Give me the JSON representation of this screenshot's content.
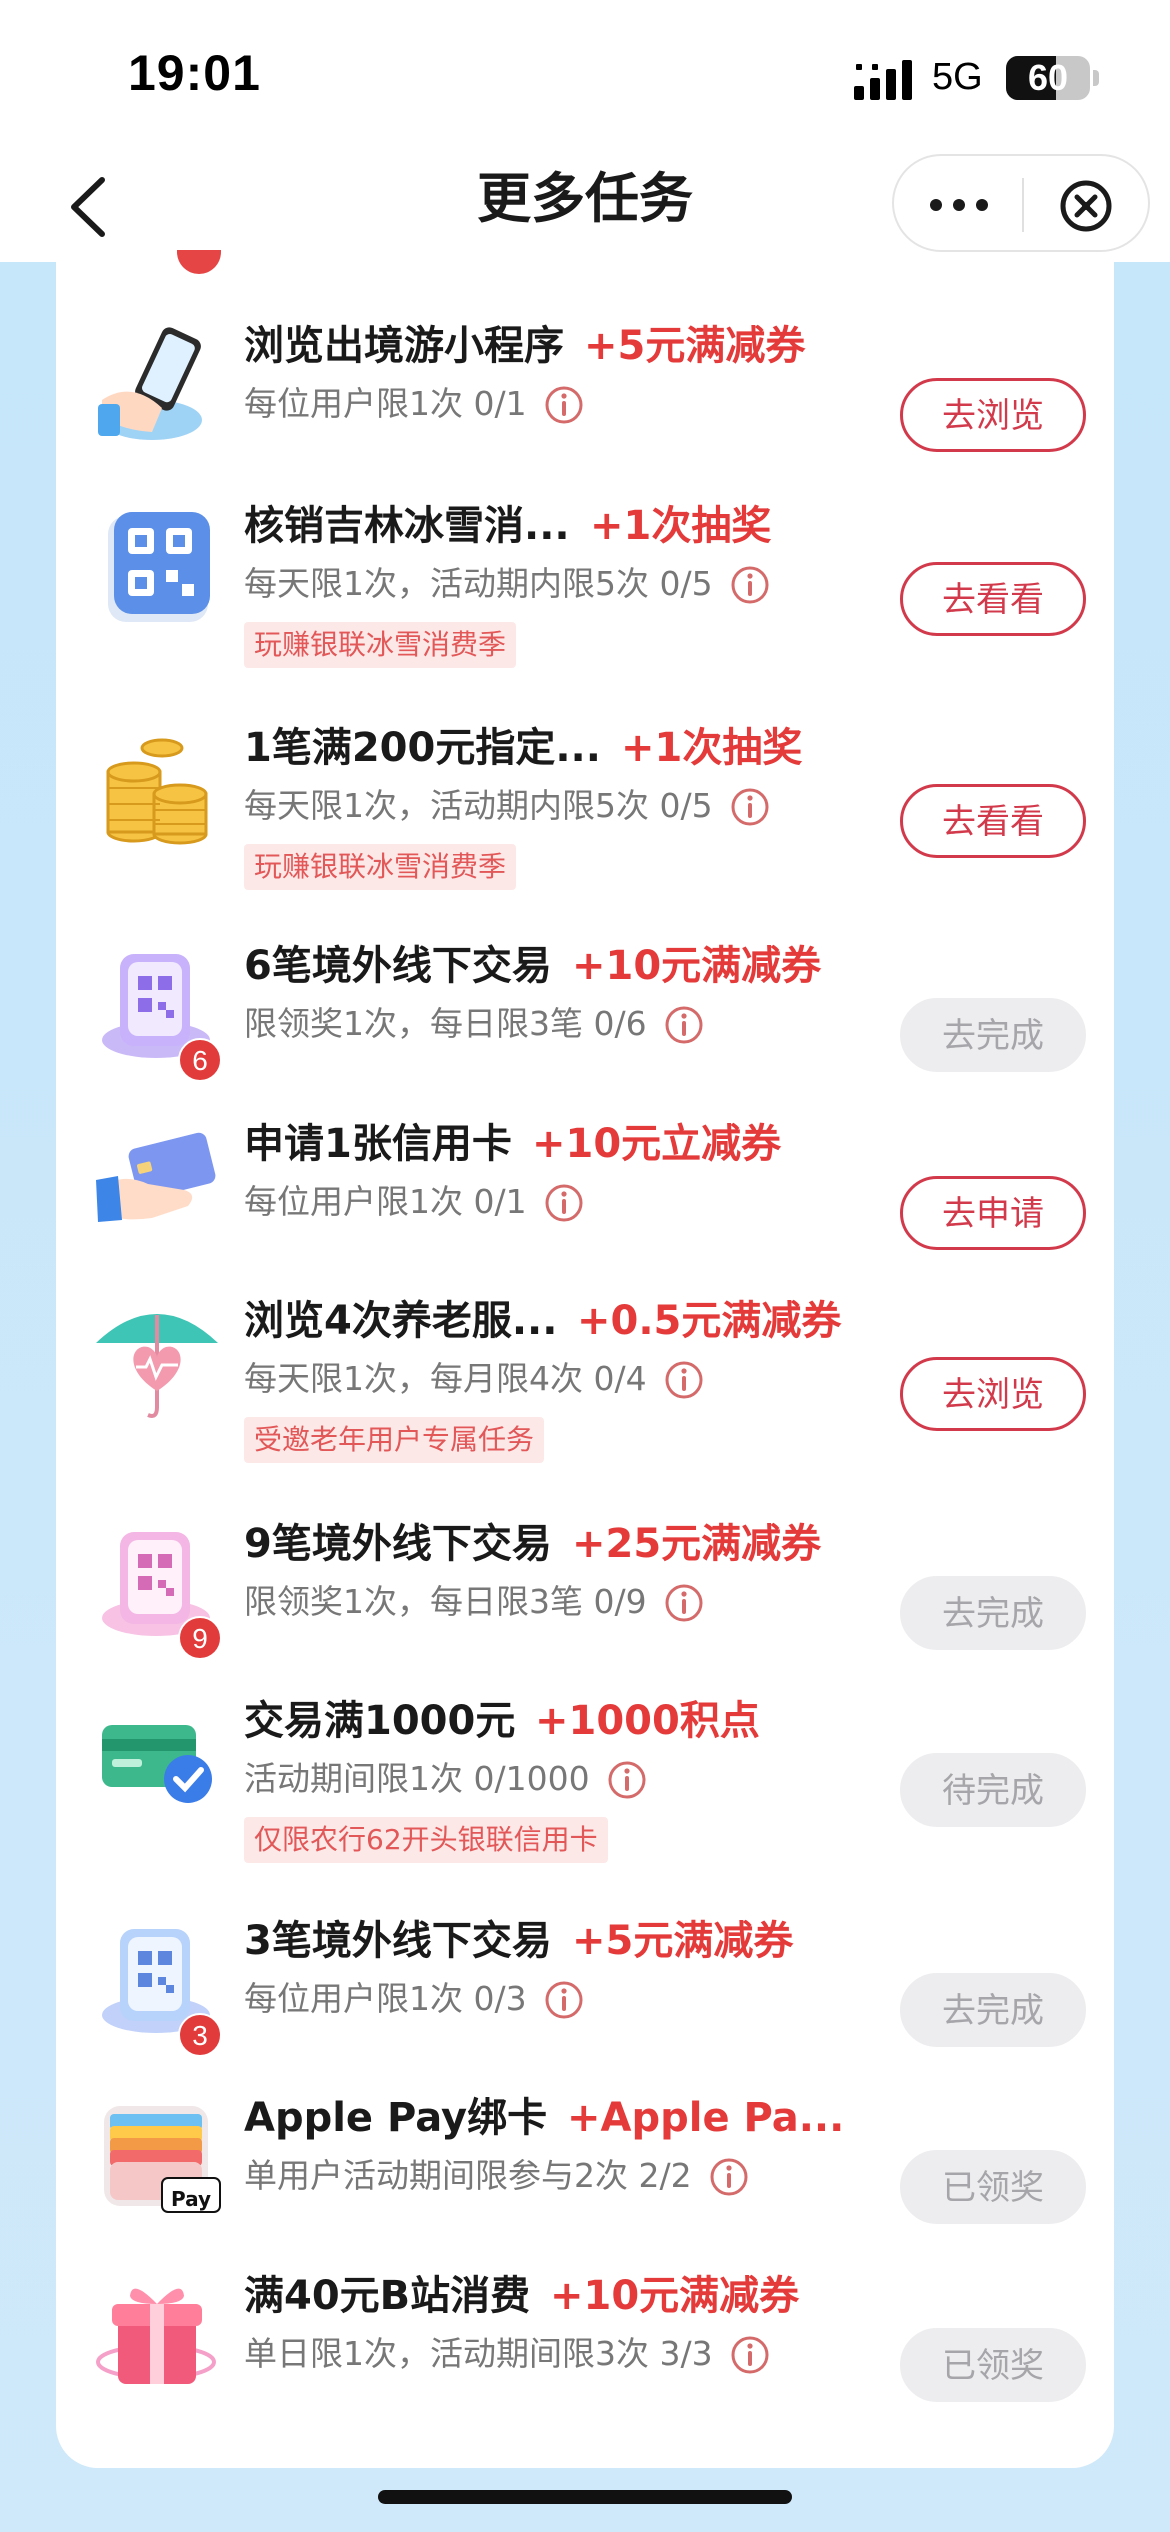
{
  "status_bar": {
    "time": "19:01",
    "network": "5G",
    "battery": "60",
    "battery_fraction": 0.6
  },
  "nav": {
    "title": "更多任务",
    "back_icon": "chevron-left-icon",
    "more_icon": "more-dots-icon",
    "close_icon": "close-circle-icon"
  },
  "colors": {
    "accent": "#e43a3a",
    "button_border": "#d23a4b",
    "tag_bg": "#fde8e8",
    "page_bg": "#c6e6fa"
  },
  "tasks": [
    {
      "name": "浏览出境游小程序",
      "reward": "+5元满减券",
      "limit": "每位用户限1次  0/1",
      "tag": "",
      "badge": "",
      "button": "去浏览",
      "button_state": "active",
      "icon": "phone-hand-icon"
    },
    {
      "name": "核销吉林冰雪消...",
      "reward": "+1次抽奖",
      "limit": "每天限1次，活动期内限5次  0/5",
      "tag": "玩赚银联冰雪消费季",
      "badge": "",
      "button": "去看看",
      "button_state": "active",
      "icon": "qr-code-icon"
    },
    {
      "name": "1笔满200元指定...",
      "reward": "+1次抽奖",
      "limit": "每天限1次，活动期内限5次  0/5",
      "tag": "玩赚银联冰雪消费季",
      "badge": "",
      "button": "去看看",
      "button_state": "active",
      "icon": "coins-icon"
    },
    {
      "name": "6笔境外线下交易",
      "reward": "+10元满减券",
      "limit": "限领奖1次，每日限3笔  0/6",
      "tag": "",
      "badge": "6",
      "button": "去完成",
      "button_state": "disabled",
      "icon": "qr-card-icon"
    },
    {
      "name": "申请1张信用卡",
      "reward": "+10元立减券",
      "limit": "每位用户限1次  0/1",
      "tag": "",
      "badge": "",
      "button": "去申请",
      "button_state": "active",
      "icon": "credit-card-hand-icon"
    },
    {
      "name": "浏览4次养老服...",
      "reward": "+0.5元满减券",
      "limit": "每天限1次，每月限4次  0/4",
      "tag": "受邀老年用户专属任务",
      "badge": "",
      "button": "去浏览",
      "button_state": "active",
      "icon": "umbrella-heart-icon"
    },
    {
      "name": "9笔境外线下交易",
      "reward": "+25元满减券",
      "limit": "限领奖1次，每日限3笔  0/9",
      "tag": "",
      "badge": "9",
      "button": "去完成",
      "button_state": "disabled",
      "icon": "qr-card-pink-icon"
    },
    {
      "name": "交易满1000元",
      "reward": "+1000积点",
      "limit": "活动期间限1次  0/1000",
      "tag": "仅限农行62开头银联信用卡",
      "badge": "",
      "button": "待完成",
      "button_state": "disabled",
      "icon": "card-check-icon"
    },
    {
      "name": "3笔境外线下交易",
      "reward": "+5元满减券",
      "limit": "每位用户限1次  0/3",
      "tag": "",
      "badge": "3",
      "button": "去完成",
      "button_state": "disabled",
      "icon": "qr-card-blue-icon"
    },
    {
      "name": "Apple Pay绑卡",
      "reward": "+Apple Pa...",
      "limit": "单用户活动期间限参与2次  2/2",
      "tag": "",
      "badge": "",
      "button": "已领奖",
      "button_state": "disabled",
      "icon": "apple-wallet-icon",
      "icon_label": "Pay"
    },
    {
      "name": "满40元B站消费",
      "reward": "+10元满减券",
      "limit": "单日限1次，活动期间限3次  3/3",
      "tag": "",
      "badge": "",
      "button": "已领奖",
      "button_state": "disabled",
      "icon": "gift-box-icon"
    }
  ]
}
